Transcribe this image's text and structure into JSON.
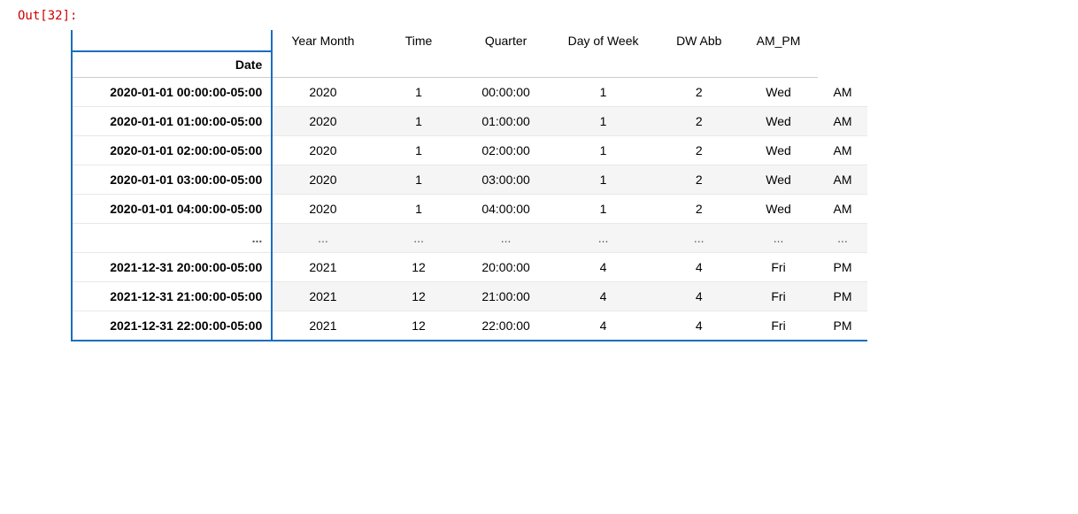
{
  "out_label": "Out[32]:",
  "columns": {
    "date": "Date",
    "year": "Year",
    "month": "Month",
    "time": "Time",
    "quarter": "Quarter",
    "day_of_week": "Day of Week",
    "dw_abb": "DW Abb",
    "am_pm": "AM_PM"
  },
  "rows": [
    {
      "date": "2020-01-01 00:00:00-05:00",
      "year": "2020",
      "month": "1",
      "time": "00:00:00",
      "quarter": "1",
      "dow": "2",
      "dwabb": "Wed",
      "ampm": "AM"
    },
    {
      "date": "2020-01-01 01:00:00-05:00",
      "year": "2020",
      "month": "1",
      "time": "01:00:00",
      "quarter": "1",
      "dow": "2",
      "dwabb": "Wed",
      "ampm": "AM"
    },
    {
      "date": "2020-01-01 02:00:00-05:00",
      "year": "2020",
      "month": "1",
      "time": "02:00:00",
      "quarter": "1",
      "dow": "2",
      "dwabb": "Wed",
      "ampm": "AM"
    },
    {
      "date": "2020-01-01 03:00:00-05:00",
      "year": "2020",
      "month": "1",
      "time": "03:00:00",
      "quarter": "1",
      "dow": "2",
      "dwabb": "Wed",
      "ampm": "AM"
    },
    {
      "date": "2020-01-01 04:00:00-05:00",
      "year": "2020",
      "month": "1",
      "time": "04:00:00",
      "quarter": "1",
      "dow": "2",
      "dwabb": "Wed",
      "ampm": "AM"
    },
    {
      "date": "...",
      "year": "...",
      "month": "...",
      "time": "...",
      "quarter": "...",
      "dow": "...",
      "dwabb": "...",
      "ampm": "..."
    },
    {
      "date": "2021-12-31 20:00:00-05:00",
      "year": "2021",
      "month": "12",
      "time": "20:00:00",
      "quarter": "4",
      "dow": "4",
      "dwabb": "Fri",
      "ampm": "PM"
    },
    {
      "date": "2021-12-31 21:00:00-05:00",
      "year": "2021",
      "month": "12",
      "time": "21:00:00",
      "quarter": "4",
      "dow": "4",
      "dwabb": "Fri",
      "ampm": "PM"
    },
    {
      "date": "2021-12-31 22:00:00-05:00",
      "year": "2021",
      "month": "12",
      "time": "22:00:00",
      "quarter": "4",
      "dow": "4",
      "dwabb": "Fri",
      "ampm": "PM"
    }
  ]
}
